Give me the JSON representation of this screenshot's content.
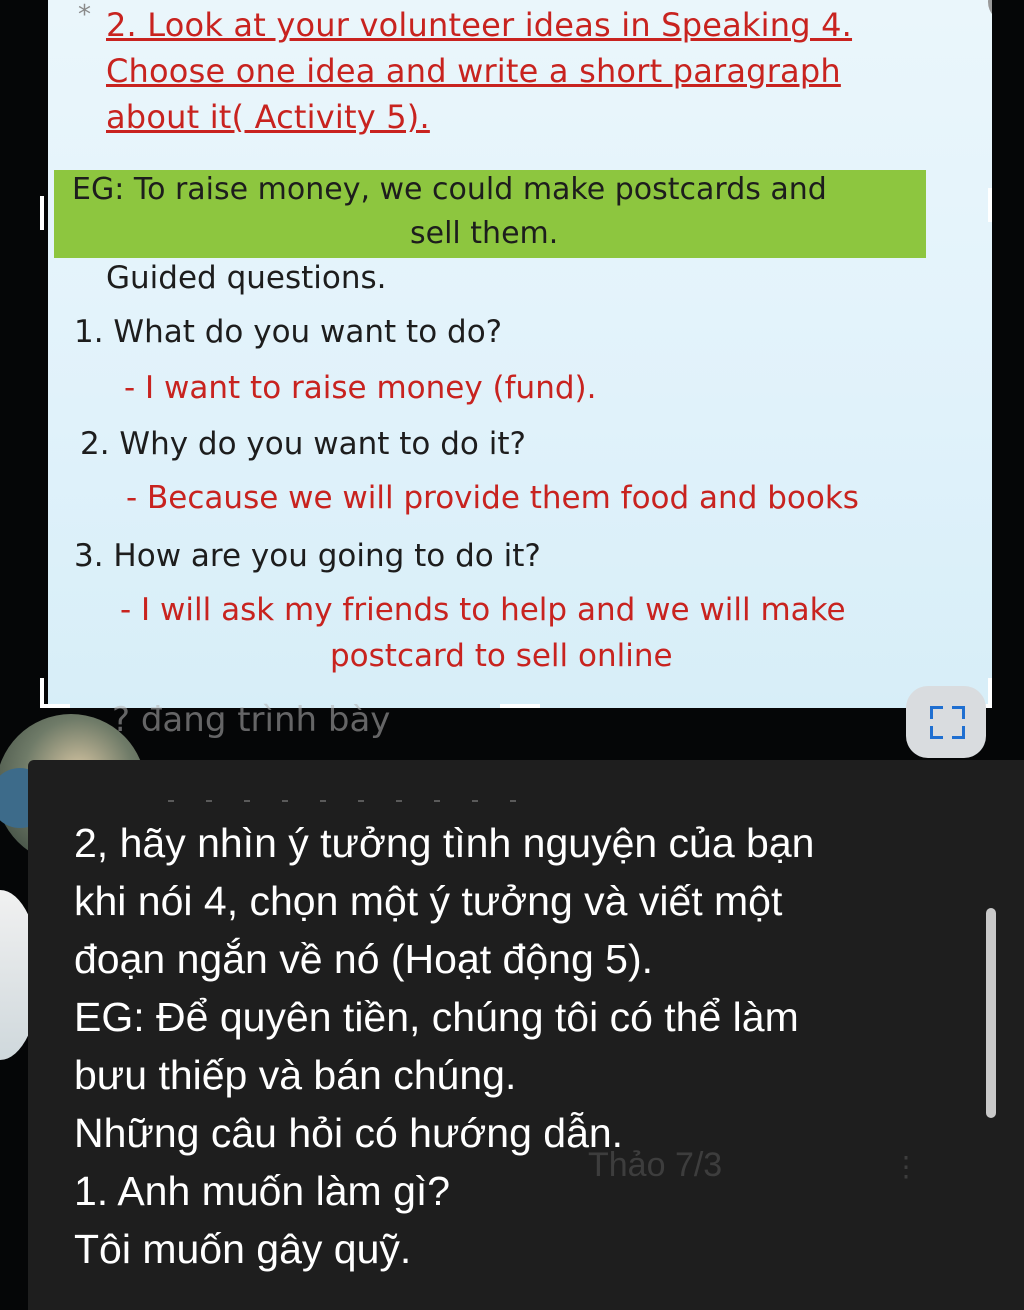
{
  "slide": {
    "asterisk": "*",
    "title_lines": [
      "2. Look at your volunteer ideas in Speaking 4.",
      "Choose one idea and write a short paragraph",
      "about it( Activity 5)."
    ],
    "example": {
      "line1": "EG: To raise money, we could make postcards and",
      "line2": "sell them."
    },
    "guided_label": "Guided questions.",
    "questions": [
      {
        "q": "1.  What do you want to do?",
        "a": "- I want to raise money (fund)."
      },
      {
        "q": "2.  Why do you want to do it?",
        "a": "- Because we will provide them food and books"
      },
      {
        "q": "3.  How are you going to do it?",
        "a": "- I will ask my friends to help and we will make",
        "a2": "postcard to sell online"
      }
    ]
  },
  "share": {
    "presenting_label": "? đang trình bày",
    "fullscreen_icon": "fullscreen-icon"
  },
  "translation": {
    "lines": [
      "2, hãy nhìn ý tưởng tình nguyện của bạn",
      "khi nói 4, chọn một ý tưởng và viết một",
      "đoạn ngắn về nó (Hoạt động 5).",
      "EG: Để quyên tiền, chúng tôi có thể làm",
      "bưu thiếp và bán chúng.",
      "Những câu hỏi có hướng dẫn.",
      "1.  Anh muốn làm gì?",
      "Tôi muốn gây quỹ."
    ],
    "background_text": "Thảo 7/3"
  },
  "colors": {
    "title_red": "#c8231f",
    "example_green": "#8dc63f",
    "panel_bg": "#1e1e1e"
  }
}
